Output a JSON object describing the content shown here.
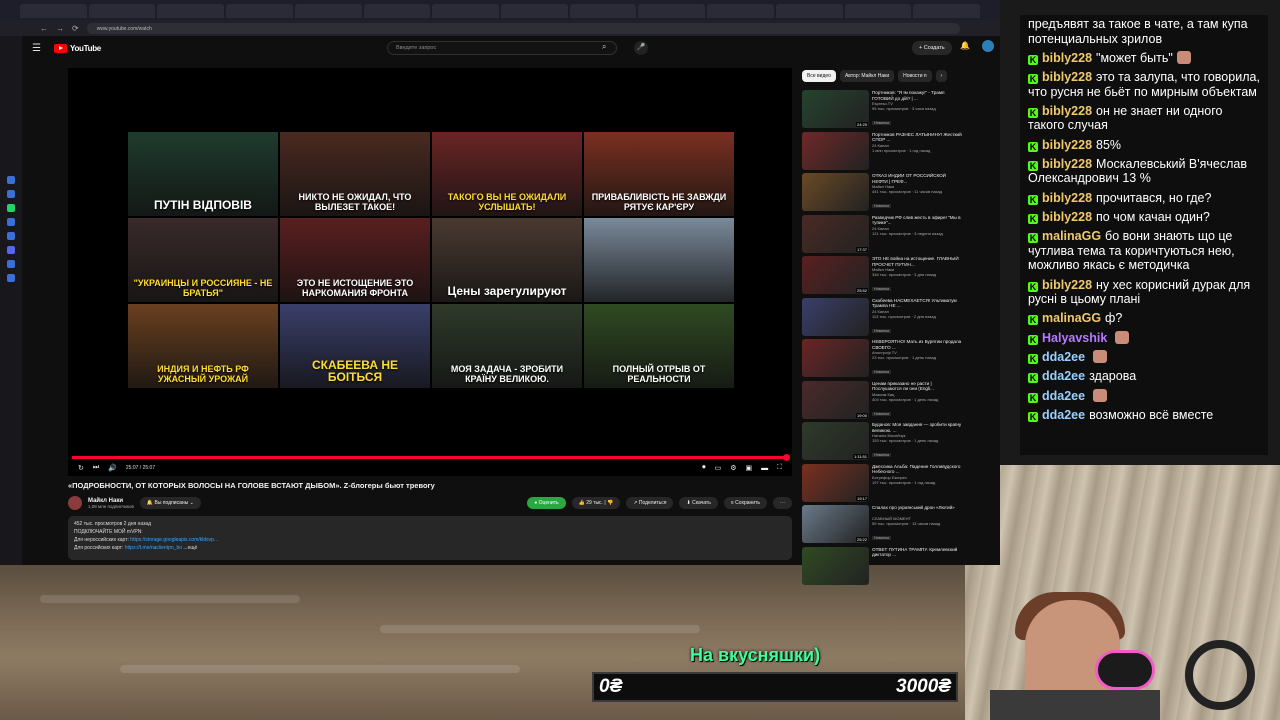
{
  "browser": {
    "tabs": [
      "",
      "",
      "",
      "",
      "",
      "",
      "",
      "",
      "",
      "",
      "",
      "",
      "",
      ""
    ],
    "url": "www.youtube.com/watch"
  },
  "youtube": {
    "logo_text": "YouTube",
    "search_placeholder": "Введите запрос",
    "create_label": "Создать"
  },
  "player": {
    "thumbnails": [
      {
        "caption": "ПУТІН ВІДПОВІВ",
        "bg": "#1f3b2e",
        "color": "#ffffff"
      },
      {
        "caption": "НИКТО НЕ ОЖИДАЛ, ЧТО ВЫЛЕЗЕТ ТАКОЕ!",
        "bg": "#4a2a20",
        "color": "#ffffff"
      },
      {
        "caption": "ТАКОГО ВЫ НЕ ОЖИДАЛИ УСЛЫШАТЬ!",
        "bg": "#6a2525",
        "color": "#ffdd33"
      },
      {
        "caption": "ПРИВАБЛИВІСТЬ НЕ ЗАВЖДИ РЯТУЄ КАР'ЄРУ",
        "bg": "#7a3020",
        "color": "#ffffff"
      },
      {
        "caption": "\"УКРАИНЦЫ И РОССИЯНЕ - НЕ БРАТЬЯ\"",
        "bg": "#3a2a2a",
        "color": "#ffdd33"
      },
      {
        "caption": "ЭТО НЕ ИСТОЩЕНИЕ ЭТО НАРКОМАНИЯ ФРОНТА",
        "bg": "#5a1f1f",
        "color": "#ffffff"
      },
      {
        "caption": "Цены зарегулируют",
        "bg": "#4a3a30",
        "color": "#ffffff"
      },
      {
        "caption": "",
        "bg": "#7a8a9a",
        "color": "#ffffff"
      },
      {
        "caption": "ИНДИЯ И НЕФТЬ РФ УЖАСНЫЙ УРОЖАЙ",
        "bg": "#6a4020",
        "color": "#ffdd33"
      },
      {
        "caption": "СКАБЕЕВА НЕ БОІТЬСЯ",
        "bg": "#3a3f6a",
        "color": "#ffdd33"
      },
      {
        "caption": "МОЯ ЗАДАЧА - ЗРОБИТИ КРАЇНУ ВЕЛИКОЮ.",
        "bg": "#2e3a2a",
        "color": "#ffffff"
      },
      {
        "caption": "ПОЛНЫЙ ОТРЫВ ОТ РЕАЛЬНОСТИ",
        "bg": "#2f4a22",
        "color": "#ffffff"
      }
    ],
    "time": "25:07 / 25:07"
  },
  "video": {
    "title": "«ПОДРОБНОСТИ, ОТ КОТОРЫХ ВОЛОСЫ НА ГОЛОВЕ ВСТАЮТ ДЫБОМ». Z-блогеры бьют тревогу",
    "channel": "Майкл Наки",
    "subscribers": "1,08 млн подписчиков",
    "subscribed_label": "Вы подписаны",
    "sponsor_label": "Оценить",
    "likes": "29 тыс.",
    "share_label": "Поделиться",
    "download_label": "Скачать",
    "save_label": "Сохранить",
    "desc_line1": "452 тыс. просмотров  2 дня назад",
    "desc_line2": "ПОДКЛЮЧАЙТЕ МОЙ mVPN:",
    "desc_line3_label": "Для нероссийских карт:",
    "desc_line3_link": "https://storage.googleapis.com/kldsvp...",
    "desc_line4_label": "Для российских карт:",
    "desc_line4_link": "https://t.me/naclientpn_bo",
    "desc_more": "...ещё"
  },
  "recs": {
    "chips": [
      "Все видео",
      "Автор: Майкл Наки",
      "Новости п"
    ],
    "items": [
      {
        "title": "Портников: \"Я їм покажу!\" - Трамп ГОТОВИЙ до дій? | ...",
        "channel": "Espreso.TV",
        "meta": "95 тыс. просмотров · 3 часа назад",
        "badge": "Новинка",
        "dur": "24:25",
        "bg": "#25432f"
      },
      {
        "title": "Портников РАЗНЕС ЛАТЫНИНУ! Жесткий СПОР ...",
        "channel": "24 Канал",
        "meta": "1 млн просмотров · 1 год назад",
        "badge": "",
        "dur": "",
        "bg": "#702828"
      },
      {
        "title": "ОТКАЗ ИНДИИ ОТ РОССИЙСКОЙ НЕФТИ | ГРЕФ...",
        "channel": "Майкл Наки",
        "meta": "441 тыс. просмотров · 11 часов назад",
        "badge": "Новинка",
        "dur": "",
        "bg": "#6a4a26"
      },
      {
        "title": "Разведчик РФ слив жесть в эфире! \"Мы в тупике\"...",
        "channel": "24 Канал",
        "meta": "121 тыс. просмотров · 3 недели назад",
        "badge": "",
        "dur": "17:37",
        "bg": "#4a2a24"
      },
      {
        "title": "ЭТО НЕ война на истощение. ГЛАВНЫЙ ПРОСЧЕТ ПУТИН...",
        "channel": "Майкл Наки",
        "meta": "346 тыс. просмотров · 3 дня назад",
        "badge": "Новинка",
        "dur": "25:52",
        "bg": "#5a2020"
      },
      {
        "title": "Скабеева НАСМЕХАЕТСЯ! Ультиматум Трампа НЕ ...",
        "channel": "24 Канал",
        "meta": "113 тыс. просмотров · 2 дня назад",
        "badge": "Новинка",
        "dur": "",
        "bg": "#3a3f6a"
      },
      {
        "title": "НЕВЕРОЯТНО! Мать из Бурятии продала СВОЕГО ...",
        "channel": "Апостроф TV",
        "meta": "23 тыс. просмотров · 1 день назад",
        "badge": "Новинка",
        "dur": "",
        "bg": "#6a2525"
      },
      {
        "title": "Ценам приказано не расти | Послушаются ли они (Engli...",
        "channel": "Максим Кац",
        "meta": "404 тыс. просмотров · 1 день назад",
        "badge": "Новинка",
        "dur": "19:00",
        "bg": "#4a2a2a"
      },
      {
        "title": "Буданов: Моя завдання — зробити країну великою. ...",
        "channel": "Наталія Мосейчук",
        "meta": "153 тыс. просмотров · 1 день назад",
        "badge": "Новинка",
        "dur": "1:11:51",
        "bg": "#2e3a2a"
      },
      {
        "title": "Джессика Альба: Падение Голливудского Небесного ...",
        "channel": "Ботрефор Експрес",
        "meta": "197 тыс. просмотров · 1 год назад",
        "badge": "",
        "dur": "19:17",
        "bg": "#7a3020"
      },
      {
        "title": "Спалах про український дрон «Лютий»",
        "channel": "СЛАВНЫЙ МОМЕНТ",
        "meta": "59 тыс. просмотров · 13 часов назад",
        "badge": "Новинка",
        "dur": "25:22",
        "bg": "#6a7a8a"
      },
      {
        "title": "ОТВЕТ ПУТИНА ТРАМПУ. Кремлевский диктатор ...",
        "channel": "",
        "meta": "",
        "badge": "",
        "dur": "",
        "bg": "#2f4a22"
      }
    ]
  },
  "chat": {
    "messages": [
      {
        "user": "",
        "text": "предъявят за такое в чате, а там купа потенциальных зрилов",
        "color": "#ffffff",
        "kick": false,
        "emote": false
      },
      {
        "user": "bibly228",
        "text": "\"может быть\"",
        "color": "#f0c96b",
        "kick": true,
        "emote": true
      },
      {
        "user": "bibly228",
        "text": "это та залупа, что говорила, что русня не бьёт по мирным объектам",
        "color": "#f0c96b",
        "kick": true,
        "emote": false
      },
      {
        "user": "bibly228",
        "text": "он не знает ни одного такого случая",
        "color": "#f0c96b",
        "kick": true,
        "emote": false
      },
      {
        "user": "bibly228",
        "text": "85%",
        "color": "#f0c96b",
        "kick": true,
        "emote": false
      },
      {
        "user": "bibly228",
        "text": "Москалевський В'ячеслав Олександрович 13 %",
        "color": "#f0c96b",
        "kick": true,
        "emote": false
      },
      {
        "user": "bibly228",
        "text": "прочитався, но где?",
        "color": "#f0c96b",
        "kick": true,
        "emote": false
      },
      {
        "user": "bibly228",
        "text": "по чом качан один?",
        "color": "#f0c96b",
        "kick": true,
        "emote": false
      },
      {
        "user": "malinaGG",
        "text": "бо вони знають що це чутлива тема та коричтуються нею, можливо якась є методичка",
        "color": "#f0c96b",
        "kick": true,
        "emote": false
      },
      {
        "user": "bibly228",
        "text": "ну хес корисний дурак для русні в цьому плані",
        "color": "#f0c96b",
        "kick": true,
        "emote": false
      },
      {
        "user": "malinaGG",
        "text": "ф?",
        "color": "#f0c96b",
        "kick": true,
        "emote": false
      },
      {
        "user": "Halyavshik",
        "text": "",
        "color": "#b57bff",
        "kick": true,
        "emote": true
      },
      {
        "user": "dda2ee",
        "text": "",
        "color": "#9ad0ff",
        "kick": true,
        "emote": true
      },
      {
        "user": "dda2ee",
        "text": "здарова",
        "color": "#9ad0ff",
        "kick": true,
        "emote": false
      },
      {
        "user": "dda2ee",
        "text": "",
        "color": "#9ad0ff",
        "kick": true,
        "emote": true
      },
      {
        "user": "dda2ee",
        "text": "возможно всё вместе",
        "color": "#9ad0ff",
        "kick": true,
        "emote": false
      }
    ]
  },
  "donation": {
    "label": "На вкусняшки)",
    "current": "0₴",
    "target": "3000₴",
    "progress": 0
  }
}
